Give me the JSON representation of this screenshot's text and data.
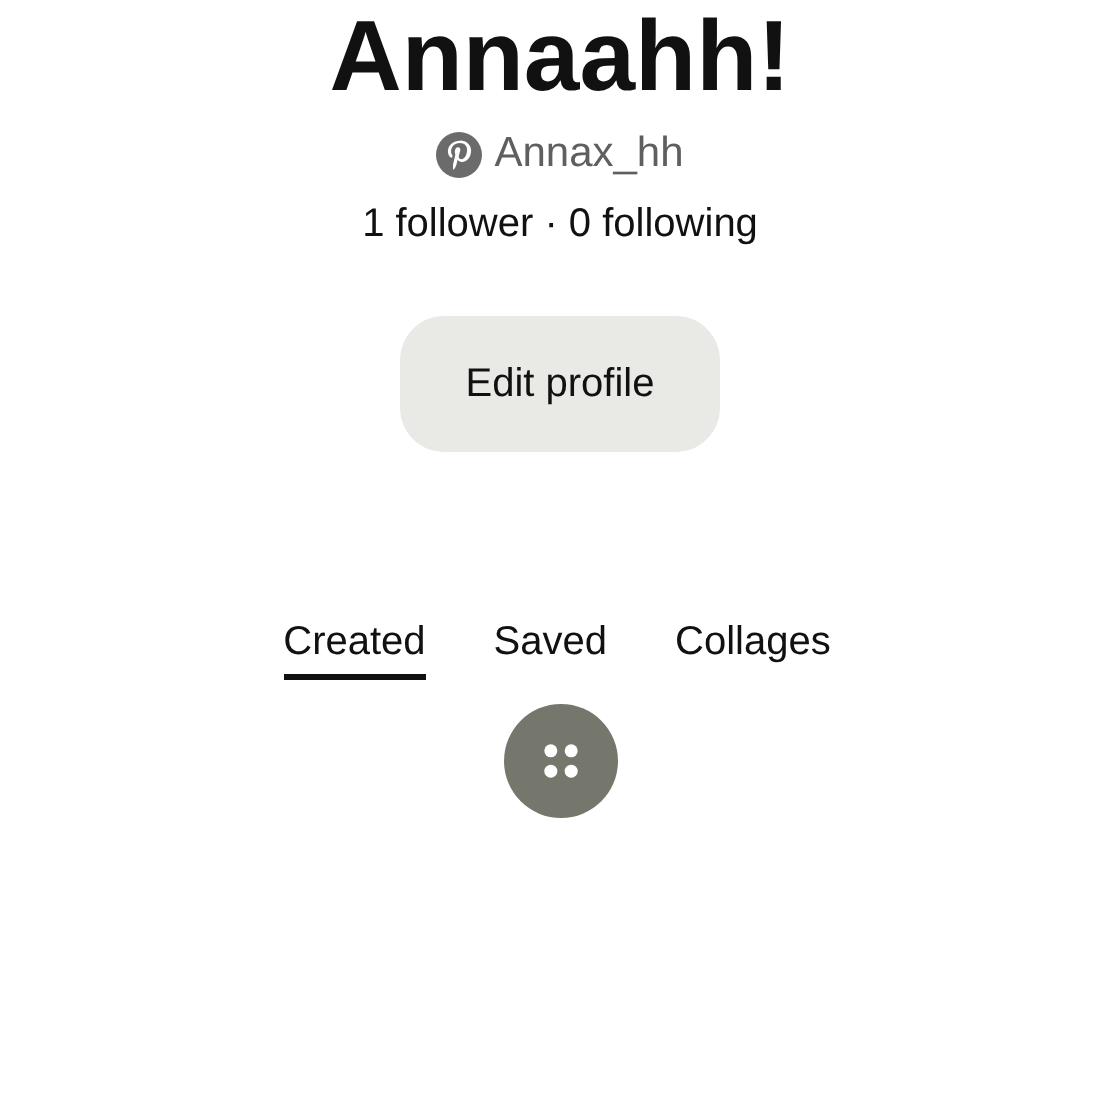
{
  "profile": {
    "name": "Annaahh!",
    "username": "Annax_hh",
    "stats": "1 follower · 0 following"
  },
  "buttons": [
    {
      "label": "Edit profile"
    }
  ],
  "tabs": [
    {
      "label": "Created",
      "selected": true
    },
    {
      "label": "Saved",
      "selected": false
    },
    {
      "label": "Collages",
      "selected": false
    }
  ]
}
